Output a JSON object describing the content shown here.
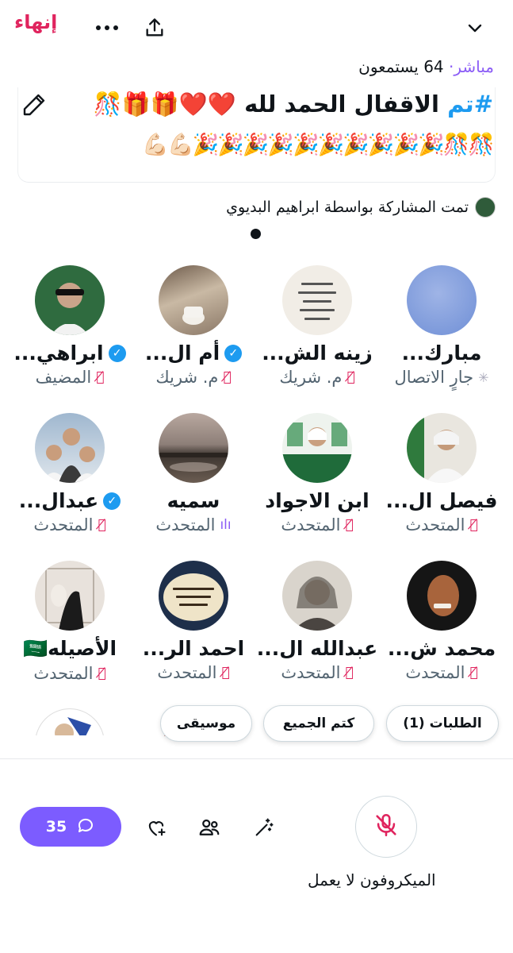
{
  "topbar": {
    "end_label": "إنهاء",
    "more_icon": "more-horizontal-icon",
    "share_icon": "share-upload-icon",
    "collapse_icon": "chevron-down-icon"
  },
  "space": {
    "live_label": "مباشر",
    "listeners": "64 يستمعون",
    "title_hashtag": "#تم",
    "title_text": "الاقفال الحمد لله ❤️❤️🎁🎁🎊",
    "title_line2": "🎊🎊🎉🎉🎉🎉🎉🎉🎉🎉🎉🎉💪🏻💪🏻",
    "shared_by": "تمت المشاركة بواسطة ابراهيم البديوي"
  },
  "participants": [
    {
      "name": "مبارك...",
      "role": "جارٍ الاتصال",
      "status": "connecting",
      "verified": false
    },
    {
      "name": "زينه الش...",
      "role": "م. شريك",
      "status": "muted",
      "verified": false
    },
    {
      "name": "أم ال...",
      "role": "م. شريك",
      "status": "muted",
      "verified": true
    },
    {
      "name": "ابراهي...",
      "role": "المضيف",
      "status": "muted",
      "verified": true
    },
    {
      "name": "فيصل ال...",
      "role": "المتحدث",
      "status": "muted",
      "verified": false
    },
    {
      "name": "ابن الاجواد",
      "role": "المتحدث",
      "status": "muted",
      "verified": false
    },
    {
      "name": "سميه",
      "role": "المتحدث",
      "status": "speaking",
      "verified": false
    },
    {
      "name": "عبدال...",
      "role": "المتحدث",
      "status": "muted",
      "verified": true
    },
    {
      "name": "محمد ش...",
      "role": "المتحدث",
      "status": "muted",
      "verified": false
    },
    {
      "name": "عبدالله ال...",
      "role": "المتحدث",
      "status": "muted",
      "verified": false
    },
    {
      "name": "احمد الر...",
      "role": "المتحدث",
      "status": "muted",
      "verified": false
    },
    {
      "name": "الأصيله🇸🇦",
      "role": "المتحدث",
      "status": "muted",
      "verified": false
    }
  ],
  "pills": {
    "requests": "الطلبات (1)",
    "mute_all": "كتم الجميع",
    "music": "موسيقى"
  },
  "bottom": {
    "comments_count": "35",
    "mic_label": "الميكروفون لا يعمل"
  },
  "colors": {
    "accent": "#7c5cff",
    "end_red": "#e0245e",
    "hashtag_blue": "#1d9bf0",
    "live_purple": "#8b5cf6"
  }
}
